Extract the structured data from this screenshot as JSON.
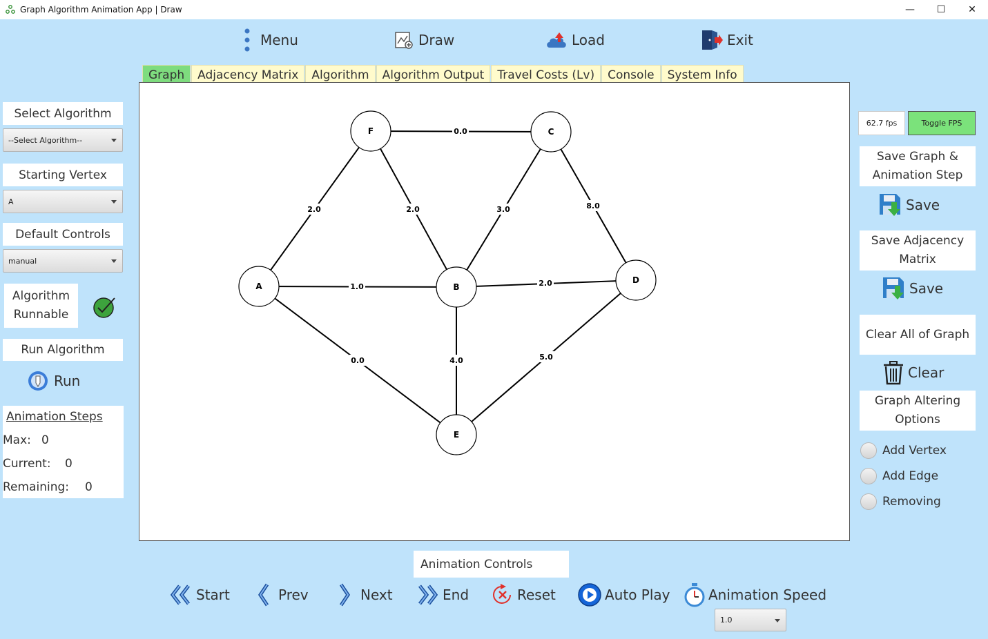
{
  "window": {
    "title": "Graph Algorithm Animation App | Draw",
    "minimize": "—",
    "maximize": "☐",
    "close": "✕"
  },
  "topnav": {
    "menu": "Menu",
    "draw": "Draw",
    "load": "Load",
    "exit": "Exit"
  },
  "tabs": [
    "Graph",
    "Adjacency Matrix",
    "Algorithm",
    "Algorithm Output",
    "Travel Costs (Lv)",
    "Console",
    "System Info"
  ],
  "left": {
    "select_algorithm_label": "Select Algorithm",
    "select_algorithm_value": "--Select Algorithm--",
    "starting_vertex_label": "Starting Vertex",
    "starting_vertex_value": "A",
    "default_controls_label": "Default Controls",
    "default_controls_value": "manual",
    "runnable_line1": "Algorithm",
    "runnable_line2": "Runnable",
    "run_algorithm_label": "Run Algorithm",
    "run_button": "Run",
    "steps_header": "Animation Steps",
    "max_label": "Max:",
    "max_value": "0",
    "current_label": "Current:",
    "current_value": "0",
    "remaining_label": "Remaining:",
    "remaining_value": "0"
  },
  "right": {
    "fps": "62.7 fps",
    "toggle_fps": "Toggle FPS",
    "save_graph_line1": "Save Graph &",
    "save_graph_line2": "Animation Step",
    "save_button_1": "Save",
    "save_matrix_line1": "Save Adjacency",
    "save_matrix_line2": "Matrix",
    "save_button_2": "Save",
    "clear_all": "Clear All of Graph",
    "clear_button": "Clear",
    "altering_line1": "Graph Altering",
    "altering_line2": "Options",
    "add_vertex": "Add Vertex",
    "add_edge": "Add Edge",
    "removing": "Removing"
  },
  "bottom": {
    "title": "Animation Controls",
    "start": "Start",
    "prev": "Prev",
    "next": "Next",
    "end": "End",
    "reset": "Reset",
    "auto_play": "Auto Play",
    "animation_speed": "Animation Speed",
    "speed_value": "1.0"
  },
  "graph": {
    "vertices": [
      {
        "id": "F",
        "label": "F"
      },
      {
        "id": "C",
        "label": "C"
      },
      {
        "id": "A",
        "label": "A"
      },
      {
        "id": "B",
        "label": "B"
      },
      {
        "id": "D",
        "label": "D"
      },
      {
        "id": "E",
        "label": "E"
      }
    ],
    "edges": [
      {
        "from": "F",
        "to": "C",
        "weight": "0.0"
      },
      {
        "from": "F",
        "to": "A",
        "weight": "2.0"
      },
      {
        "from": "F",
        "to": "B",
        "weight": "2.0"
      },
      {
        "from": "C",
        "to": "B",
        "weight": "3.0"
      },
      {
        "from": "C",
        "to": "D",
        "weight": "8.0"
      },
      {
        "from": "A",
        "to": "B",
        "weight": "1.0"
      },
      {
        "from": "B",
        "to": "D",
        "weight": "2.0"
      },
      {
        "from": "A",
        "to": "E",
        "weight": "0.0"
      },
      {
        "from": "B",
        "to": "E",
        "weight": "4.0"
      },
      {
        "from": "D",
        "to": "E",
        "weight": "5.0"
      }
    ]
  }
}
